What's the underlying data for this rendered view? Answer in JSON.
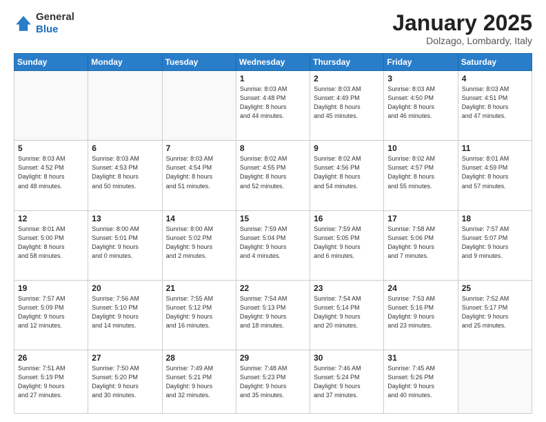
{
  "header": {
    "logo_general": "General",
    "logo_blue": "Blue",
    "title": "January 2025",
    "subtitle": "Dolzago, Lombardy, Italy"
  },
  "columns": [
    "Sunday",
    "Monday",
    "Tuesday",
    "Wednesday",
    "Thursday",
    "Friday",
    "Saturday"
  ],
  "weeks": [
    [
      {
        "day": "",
        "sunrise": "",
        "sunset": "",
        "daylight": ""
      },
      {
        "day": "",
        "sunrise": "",
        "sunset": "",
        "daylight": ""
      },
      {
        "day": "",
        "sunrise": "",
        "sunset": "",
        "daylight": ""
      },
      {
        "day": "1",
        "sunrise": "Sunrise: 8:03 AM",
        "sunset": "Sunset: 4:48 PM",
        "daylight": "Daylight: 8 hours and 44 minutes."
      },
      {
        "day": "2",
        "sunrise": "Sunrise: 8:03 AM",
        "sunset": "Sunset: 4:49 PM",
        "daylight": "Daylight: 8 hours and 45 minutes."
      },
      {
        "day": "3",
        "sunrise": "Sunrise: 8:03 AM",
        "sunset": "Sunset: 4:50 PM",
        "daylight": "Daylight: 8 hours and 46 minutes."
      },
      {
        "day": "4",
        "sunrise": "Sunrise: 8:03 AM",
        "sunset": "Sunset: 4:51 PM",
        "daylight": "Daylight: 8 hours and 47 minutes."
      }
    ],
    [
      {
        "day": "5",
        "sunrise": "Sunrise: 8:03 AM",
        "sunset": "Sunset: 4:52 PM",
        "daylight": "Daylight: 8 hours and 48 minutes."
      },
      {
        "day": "6",
        "sunrise": "Sunrise: 8:03 AM",
        "sunset": "Sunset: 4:53 PM",
        "daylight": "Daylight: 8 hours and 50 minutes."
      },
      {
        "day": "7",
        "sunrise": "Sunrise: 8:03 AM",
        "sunset": "Sunset: 4:54 PM",
        "daylight": "Daylight: 8 hours and 51 minutes."
      },
      {
        "day": "8",
        "sunrise": "Sunrise: 8:02 AM",
        "sunset": "Sunset: 4:55 PM",
        "daylight": "Daylight: 8 hours and 52 minutes."
      },
      {
        "day": "9",
        "sunrise": "Sunrise: 8:02 AM",
        "sunset": "Sunset: 4:56 PM",
        "daylight": "Daylight: 8 hours and 54 minutes."
      },
      {
        "day": "10",
        "sunrise": "Sunrise: 8:02 AM",
        "sunset": "Sunset: 4:57 PM",
        "daylight": "Daylight: 8 hours and 55 minutes."
      },
      {
        "day": "11",
        "sunrise": "Sunrise: 8:01 AM",
        "sunset": "Sunset: 4:59 PM",
        "daylight": "Daylight: 8 hours and 57 minutes."
      }
    ],
    [
      {
        "day": "12",
        "sunrise": "Sunrise: 8:01 AM",
        "sunset": "Sunset: 5:00 PM",
        "daylight": "Daylight: 8 hours and 58 minutes."
      },
      {
        "day": "13",
        "sunrise": "Sunrise: 8:00 AM",
        "sunset": "Sunset: 5:01 PM",
        "daylight": "Daylight: 9 hours and 0 minutes."
      },
      {
        "day": "14",
        "sunrise": "Sunrise: 8:00 AM",
        "sunset": "Sunset: 5:02 PM",
        "daylight": "Daylight: 9 hours and 2 minutes."
      },
      {
        "day": "15",
        "sunrise": "Sunrise: 7:59 AM",
        "sunset": "Sunset: 5:04 PM",
        "daylight": "Daylight: 9 hours and 4 minutes."
      },
      {
        "day": "16",
        "sunrise": "Sunrise: 7:59 AM",
        "sunset": "Sunset: 5:05 PM",
        "daylight": "Daylight: 9 hours and 6 minutes."
      },
      {
        "day": "17",
        "sunrise": "Sunrise: 7:58 AM",
        "sunset": "Sunset: 5:06 PM",
        "daylight": "Daylight: 9 hours and 7 minutes."
      },
      {
        "day": "18",
        "sunrise": "Sunrise: 7:57 AM",
        "sunset": "Sunset: 5:07 PM",
        "daylight": "Daylight: 9 hours and 9 minutes."
      }
    ],
    [
      {
        "day": "19",
        "sunrise": "Sunrise: 7:57 AM",
        "sunset": "Sunset: 5:09 PM",
        "daylight": "Daylight: 9 hours and 12 minutes."
      },
      {
        "day": "20",
        "sunrise": "Sunrise: 7:56 AM",
        "sunset": "Sunset: 5:10 PM",
        "daylight": "Daylight: 9 hours and 14 minutes."
      },
      {
        "day": "21",
        "sunrise": "Sunrise: 7:55 AM",
        "sunset": "Sunset: 5:12 PM",
        "daylight": "Daylight: 9 hours and 16 minutes."
      },
      {
        "day": "22",
        "sunrise": "Sunrise: 7:54 AM",
        "sunset": "Sunset: 5:13 PM",
        "daylight": "Daylight: 9 hours and 18 minutes."
      },
      {
        "day": "23",
        "sunrise": "Sunrise: 7:54 AM",
        "sunset": "Sunset: 5:14 PM",
        "daylight": "Daylight: 9 hours and 20 minutes."
      },
      {
        "day": "24",
        "sunrise": "Sunrise: 7:53 AM",
        "sunset": "Sunset: 5:16 PM",
        "daylight": "Daylight: 9 hours and 23 minutes."
      },
      {
        "day": "25",
        "sunrise": "Sunrise: 7:52 AM",
        "sunset": "Sunset: 5:17 PM",
        "daylight": "Daylight: 9 hours and 25 minutes."
      }
    ],
    [
      {
        "day": "26",
        "sunrise": "Sunrise: 7:51 AM",
        "sunset": "Sunset: 5:19 PM",
        "daylight": "Daylight: 9 hours and 27 minutes."
      },
      {
        "day": "27",
        "sunrise": "Sunrise: 7:50 AM",
        "sunset": "Sunset: 5:20 PM",
        "daylight": "Daylight: 9 hours and 30 minutes."
      },
      {
        "day": "28",
        "sunrise": "Sunrise: 7:49 AM",
        "sunset": "Sunset: 5:21 PM",
        "daylight": "Daylight: 9 hours and 32 minutes."
      },
      {
        "day": "29",
        "sunrise": "Sunrise: 7:48 AM",
        "sunset": "Sunset: 5:23 PM",
        "daylight": "Daylight: 9 hours and 35 minutes."
      },
      {
        "day": "30",
        "sunrise": "Sunrise: 7:46 AM",
        "sunset": "Sunset: 5:24 PM",
        "daylight": "Daylight: 9 hours and 37 minutes."
      },
      {
        "day": "31",
        "sunrise": "Sunrise: 7:45 AM",
        "sunset": "Sunset: 5:26 PM",
        "daylight": "Daylight: 9 hours and 40 minutes."
      },
      {
        "day": "",
        "sunrise": "",
        "sunset": "",
        "daylight": ""
      }
    ]
  ]
}
